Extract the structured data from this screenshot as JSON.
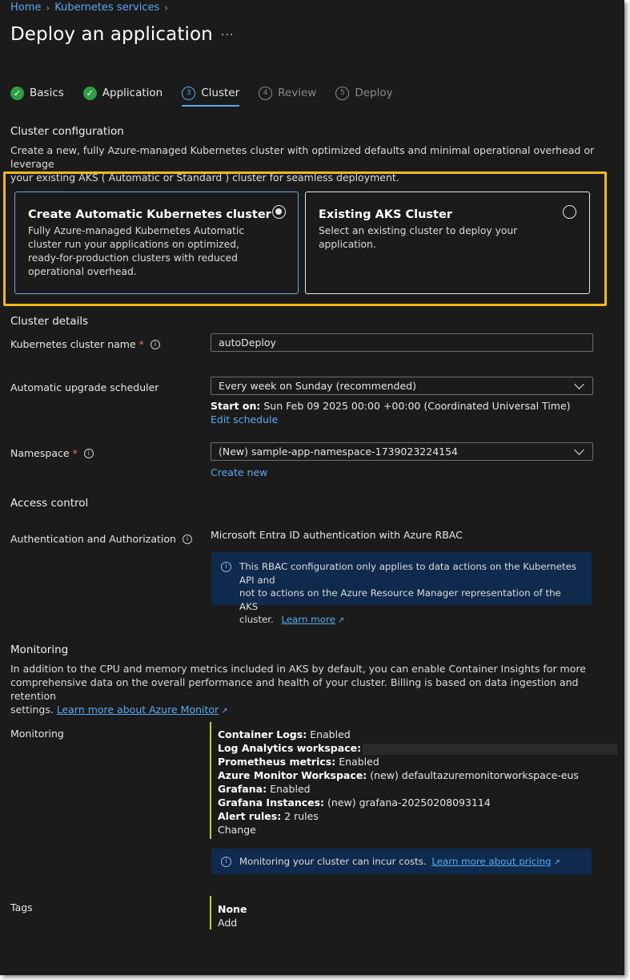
{
  "breadcrumb": {
    "home": "Home",
    "k8s": "Kubernetes services"
  },
  "page": {
    "title": "Deploy an application",
    "more": "···"
  },
  "steps": [
    {
      "num": "✓",
      "label": "Basics"
    },
    {
      "num": "✓",
      "label": "Application"
    },
    {
      "num": "3",
      "label": "Cluster"
    },
    {
      "num": "4",
      "label": "Review"
    },
    {
      "num": "5",
      "label": "Deploy"
    }
  ],
  "cluster_config": {
    "heading": "Cluster configuration",
    "desc1": "Create a new, fully Azure-managed Kubernetes cluster with optimized defaults and minimal operational overhead or leverage",
    "desc2": "your existing AKS ( Automatic or Standard ) cluster for seamless deployment.",
    "auto_card": {
      "title": "Create Automatic Kubernetes cluster",
      "desc": "Fully Azure-managed Kubernetes Automatic cluster run your applications on optimized, ready-for-production clusters with reduced operational overhead."
    },
    "existing_card": {
      "title": "Existing AKS Cluster",
      "desc": "Select an existing cluster to deploy your application."
    }
  },
  "cluster_details": {
    "heading": "Cluster details",
    "name_label": "Kubernetes cluster name",
    "name_value": "autoDeploy",
    "upgrade_label": "Automatic upgrade scheduler",
    "upgrade_value": "Every week on Sunday (recommended)",
    "start_label": "Start on:",
    "start_value": "Sun Feb 09 2025 00:00 +00:00 (Coordinated Universal Time)",
    "edit_schedule": "Edit schedule",
    "namespace_label": "Namespace",
    "namespace_value": "(New) sample-app-namespace-1739023224154",
    "create_new": "Create new"
  },
  "access": {
    "heading": "Access control",
    "auth_label": "Authentication and Authorization",
    "auth_value": "Microsoft Entra ID authentication with Azure RBAC",
    "info_line1": "This RBAC configuration only applies to data actions on the Kubernetes API and",
    "info_line2": "not to actions on the Azure Resource Manager representation of the AKS",
    "info_line3": "cluster.",
    "learn_more": "Learn more"
  },
  "monitoring": {
    "heading": "Monitoring",
    "desc1": "In addition to the CPU and memory metrics included in AKS by default, you can enable Container Insights for more",
    "desc2": "comprehensive data on the overall performance and health of your cluster. Billing is based on data ingestion and retention",
    "desc3": "settings.",
    "learn_azure_monitor": "Learn more about Azure Monitor",
    "label": "Monitoring",
    "container_logs_k": "Container Logs:",
    "container_logs_v": "Enabled",
    "law_k": "Log Analytics workspace:",
    "prom_k": "Prometheus metrics:",
    "prom_v": "Enabled",
    "amw_k": "Azure Monitor Workspace:",
    "amw_v": "(new) defaultazuremonitorworkspace-eus",
    "grafana_k": "Grafana:",
    "grafana_v": "Enabled",
    "grafana_inst_k": "Grafana Instances:",
    "grafana_inst_v": "(new) grafana-20250208093114",
    "alert_k": "Alert rules:",
    "alert_v": "2 rules",
    "change": "Change",
    "cost_text": "Monitoring your cluster can incur costs.",
    "learn_pricing": "Learn more about pricing"
  },
  "tags": {
    "label": "Tags",
    "value": "None",
    "add": "Add"
  },
  "colors": {
    "background": "#1b1b1b",
    "accent_link": "#59a9f2",
    "highlight": "#f2b81c",
    "success": "#2f9e44",
    "info_bg": "#0f2a4d",
    "group_bar": "#b7d433"
  }
}
